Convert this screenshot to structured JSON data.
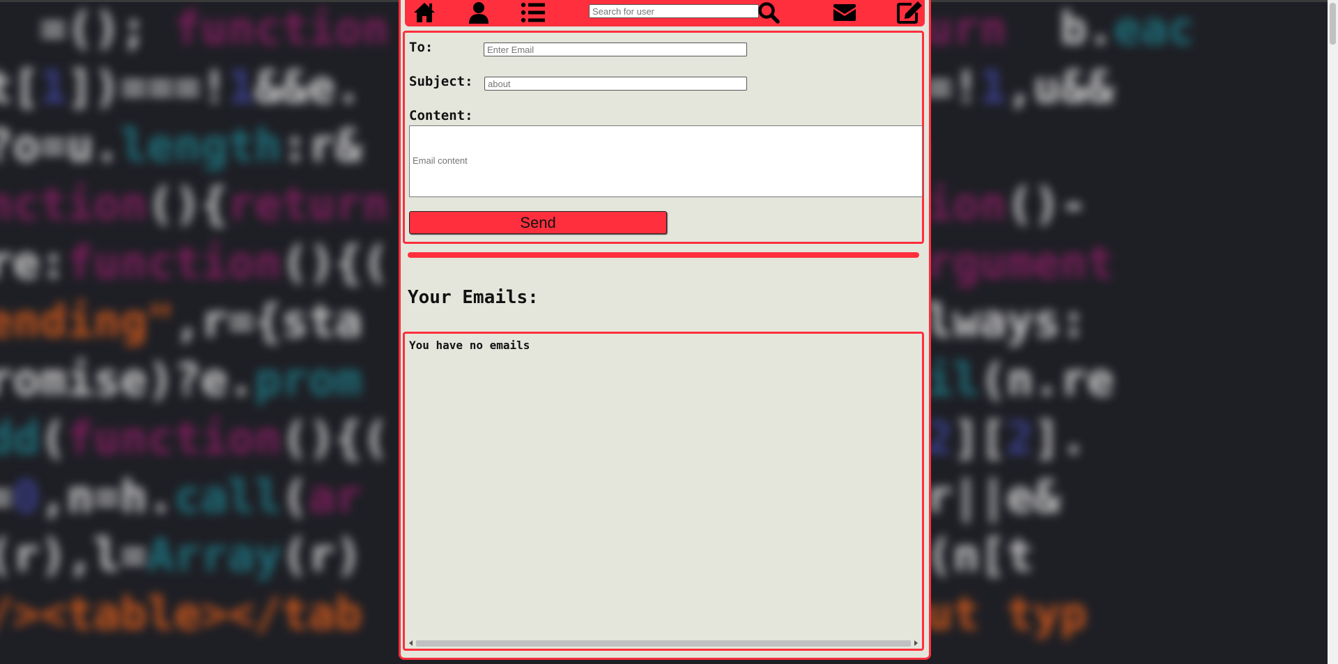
{
  "navbar": {
    "search_placeholder": "Search for user",
    "icons": [
      "home-icon",
      "user-icon",
      "list-icon",
      "search-icon",
      "envelope-icon",
      "edit-icon"
    ]
  },
  "compose": {
    "to_label": "To:",
    "to_placeholder": "Enter Email",
    "subject_label": "Subject:",
    "subject_placeholder": "about",
    "content_label": "Content:",
    "content_placeholder": "Email content",
    "send_label": "Send"
  },
  "emails": {
    "heading": "Your Emails:",
    "empty_message": "You have no emails"
  },
  "colors": {
    "accent": "#ff2f3d",
    "panel_bg": "#e4e6dc"
  }
}
